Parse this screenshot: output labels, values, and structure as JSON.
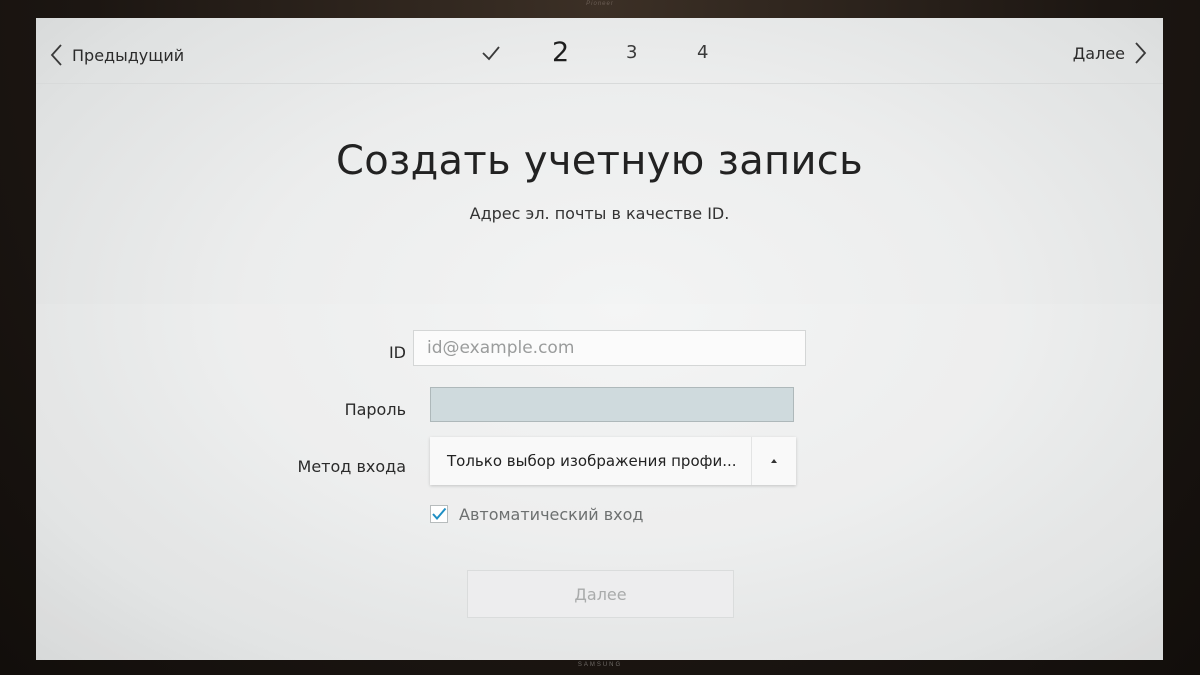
{
  "bezel": {
    "top_logo": "Pioneer",
    "bottom_logo": "SAMSUNG"
  },
  "header": {
    "prev_label": "Предыдущий",
    "next_label": "Далее",
    "steps": {
      "completed_icon": "check-icon",
      "current": "2",
      "step3": "3",
      "step4": "4"
    }
  },
  "main": {
    "title": "Создать учетную запись",
    "subtitle": "Адрес эл. почты в качестве ID."
  },
  "form": {
    "id_label": "ID",
    "id_placeholder": "id@example.com",
    "password_label": "Пароль",
    "password_value": "",
    "method_label": "Метод входа",
    "method_value": "Только выбор изображения профи...",
    "auto_login_label": "Автоматический вход",
    "auto_login_checked": true,
    "submit_label": "Далее"
  },
  "colors": {
    "accent": "#1f8fc4",
    "text_dark": "#222222",
    "text_disabled": "#a9abab",
    "password_field": "#cfdadd"
  }
}
